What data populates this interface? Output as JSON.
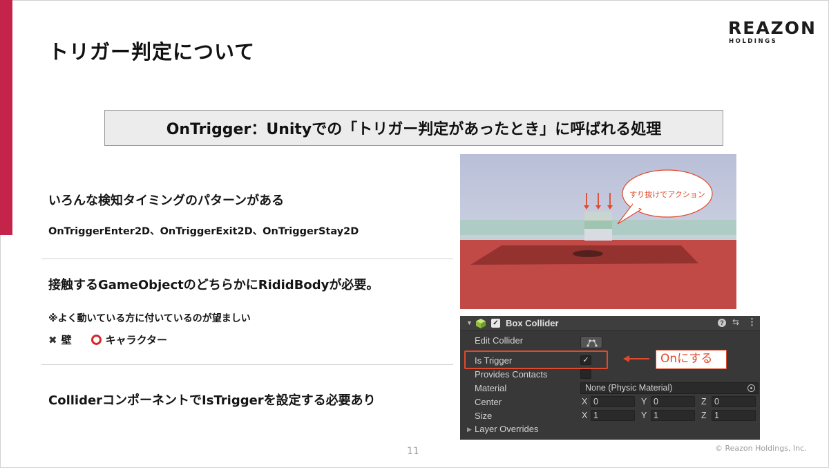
{
  "slide": {
    "title": "トリガー判定について",
    "logo": {
      "main": "REAZON",
      "sub": "HOLDINGS"
    },
    "banner": "OnTrigger：Unityでの「トリガー判定があったとき」に呼ばれる処理",
    "page_number": "11",
    "copyright": "© Reazon Holdings, Inc."
  },
  "sections": {
    "timing": {
      "heading": "いろんな検知タイミングのパターンがある",
      "methods": "OnTriggerEnter2D、OnTriggerExit2D、OnTriggerStay2D"
    },
    "rigidbody": {
      "heading": "接触するGameObjectのどちらかにRididBodyが必要。",
      "note": "※よく動いている方に付いているのが望ましい",
      "bad_mark": "✖",
      "bad_example": "壁",
      "good_example": "キャラクター"
    },
    "collider": {
      "heading": "ColliderコンポーネントでIsTriggerを設定する必要あり"
    }
  },
  "scene": {
    "speech_bubble": "すり抜けでアクション",
    "colors": {
      "sky": "#cfd4e6",
      "floor": "#c24a46",
      "floor_dark": "#8c2e2c",
      "water": "#a9cbbf",
      "arrow": "#e0492a"
    }
  },
  "inspector": {
    "component_title": "Box Collider",
    "enabled_check": "✓",
    "help_glyph": "?",
    "preset_glyph": "⇆",
    "menu_glyph": "⋮",
    "fold_open": "▼",
    "fold_closed": "▶",
    "edit_collider": "Edit Collider",
    "is_trigger": {
      "label": "Is Trigger",
      "checked": true,
      "check": "✓"
    },
    "provides_contacts": {
      "label": "Provides Contacts",
      "checked": false
    },
    "material": {
      "label": "Material",
      "value": "None (Physic Material)"
    },
    "center": {
      "label": "Center",
      "axes": [
        "X",
        "Y",
        "Z"
      ],
      "values": [
        "0",
        "0",
        "0"
      ]
    },
    "size": {
      "label": "Size",
      "axes": [
        "X",
        "Y",
        "Z"
      ],
      "values": [
        "1",
        "1",
        "1"
      ]
    },
    "layer_overrides": "Layer Overrides",
    "colors": {
      "panel": "#383838",
      "field": "#2a2a2a",
      "text": "#d2d2d2"
    }
  },
  "callout": {
    "text": "Onにする",
    "color": "#e0492a"
  }
}
